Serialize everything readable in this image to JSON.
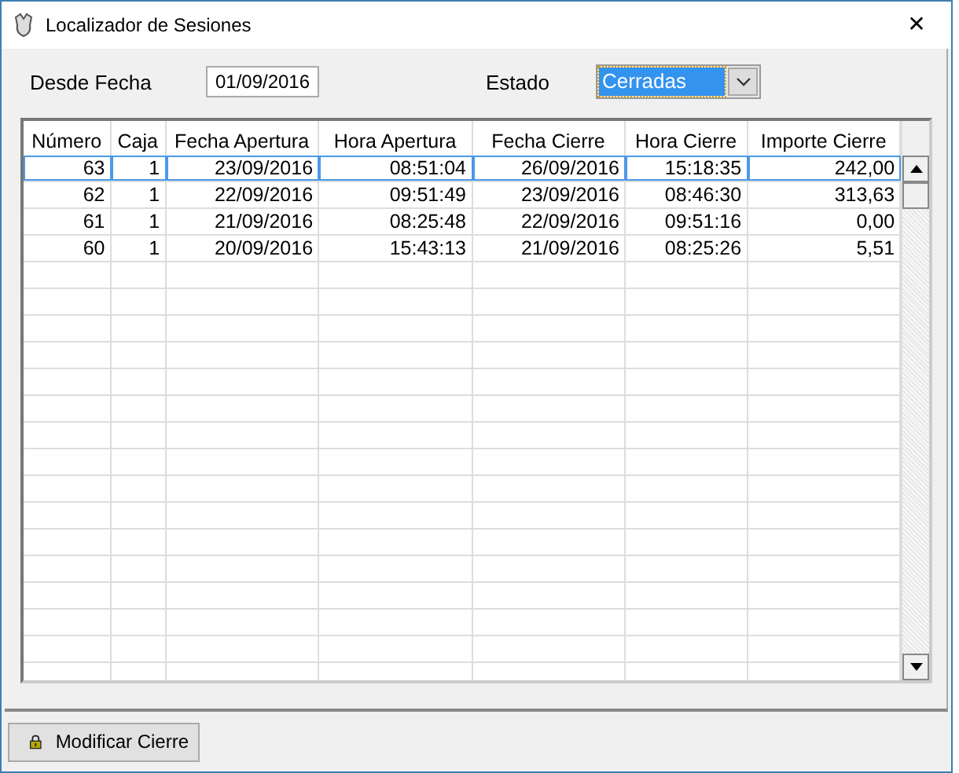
{
  "window": {
    "title": "Localizador de Sesiones",
    "close": "✕"
  },
  "filters": {
    "date_label": "Desde Fecha",
    "date_value": "01/09/2016",
    "state_label": "Estado",
    "state_value": "Cerradas",
    "state_focused": true
  },
  "table": {
    "columns": [
      "Número",
      "Caja",
      "Fecha Apertura",
      "Hora Apertura",
      "Fecha Cierre",
      "Hora Cierre",
      "Importe Cierre"
    ],
    "rows": [
      {
        "cells": [
          "63",
          "1",
          "23/09/2016",
          "08:51:04",
          "26/09/2016",
          "15:18:35",
          "242,00"
        ],
        "selected": true
      },
      {
        "cells": [
          "62",
          "1",
          "22/09/2016",
          "09:51:49",
          "23/09/2016",
          "08:46:30",
          "313,63"
        ],
        "selected": false
      },
      {
        "cells": [
          "61",
          "1",
          "21/09/2016",
          "08:25:48",
          "22/09/2016",
          "09:51:16",
          "0,00"
        ],
        "selected": false
      },
      {
        "cells": [
          "60",
          "1",
          "20/09/2016",
          "15:43:13",
          "21/09/2016",
          "08:25:26",
          "5,51"
        ],
        "selected": false
      }
    ]
  },
  "buttons": [
    {
      "label": "Modificar Cierre"
    }
  ]
}
